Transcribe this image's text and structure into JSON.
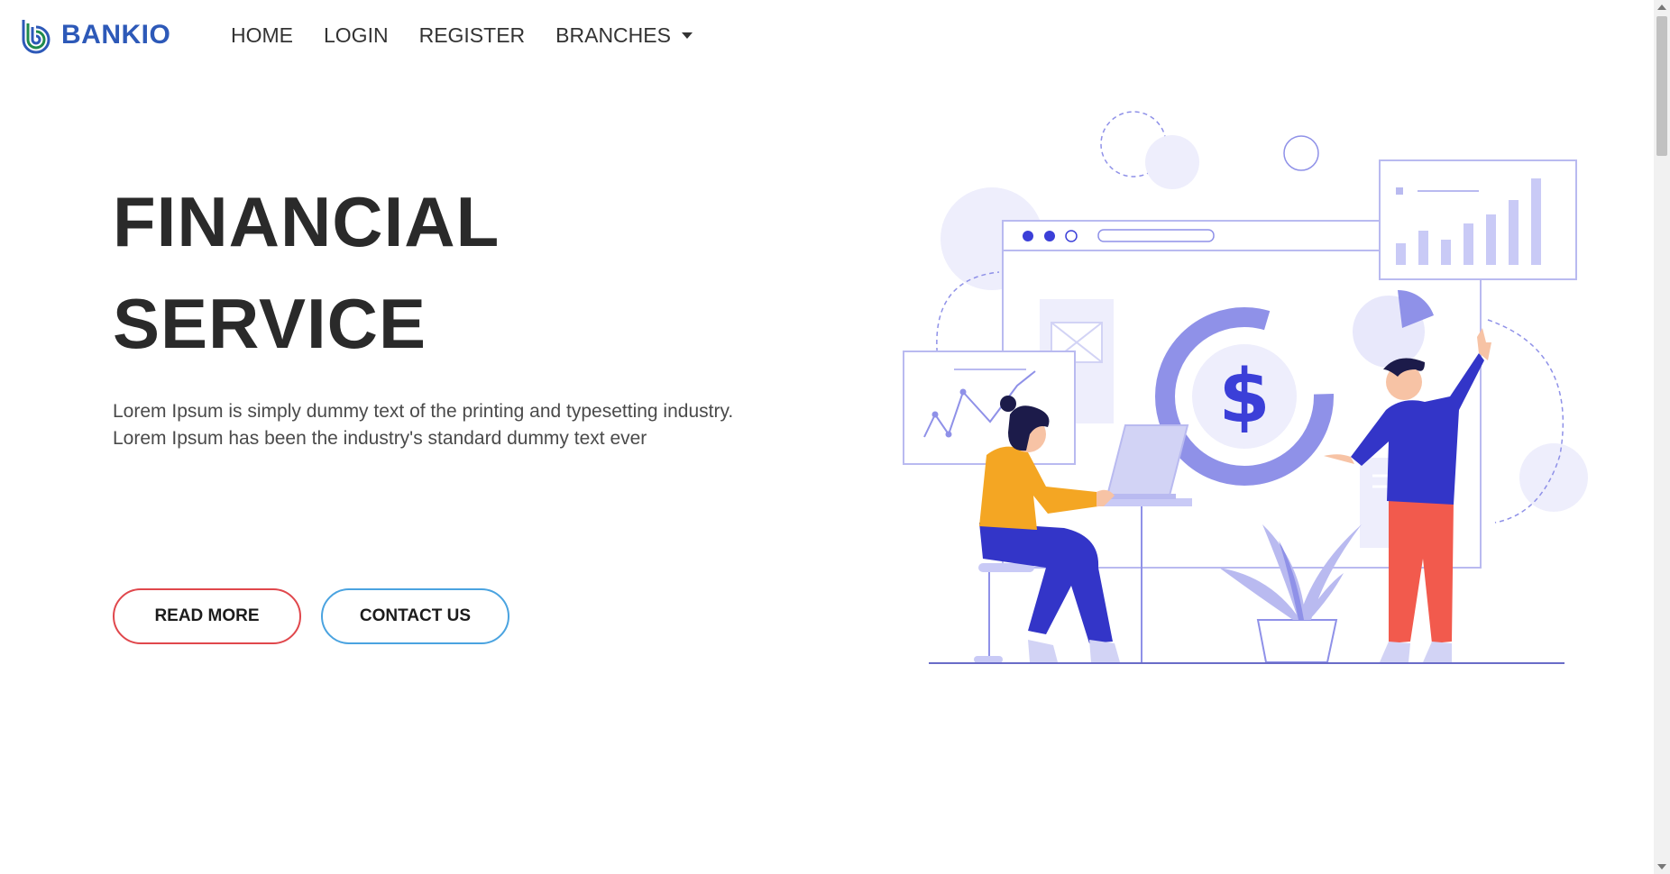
{
  "brand": {
    "name": "BANKIO",
    "logo_icon": "bankio-spiral-logo-icon",
    "color": "#2d59b8"
  },
  "nav": {
    "items": [
      {
        "label": "HOME"
      },
      {
        "label": "LOGIN"
      },
      {
        "label": "REGISTER"
      },
      {
        "label": "BRANCHES"
      }
    ],
    "dropdown_icon": "caret-down-icon"
  },
  "hero": {
    "title_line1": "FINANCIAL",
    "title_line2": "SERVICE",
    "description": "Lorem Ipsum is simply dummy text of the printing and typesetting industry. Lorem Ipsum has been the industry's standard dummy text ever",
    "read_more_label": "READ MORE",
    "contact_label": "CONTACT US"
  },
  "colors": {
    "read_more_border": "#e0474c",
    "contact_border": "#4aa3e0",
    "illustration_accent": "#3b3fd8",
    "illustration_light": "#e8e8fb"
  },
  "illustration": {
    "icon": "financial-service-illustration",
    "symbol": "$"
  }
}
